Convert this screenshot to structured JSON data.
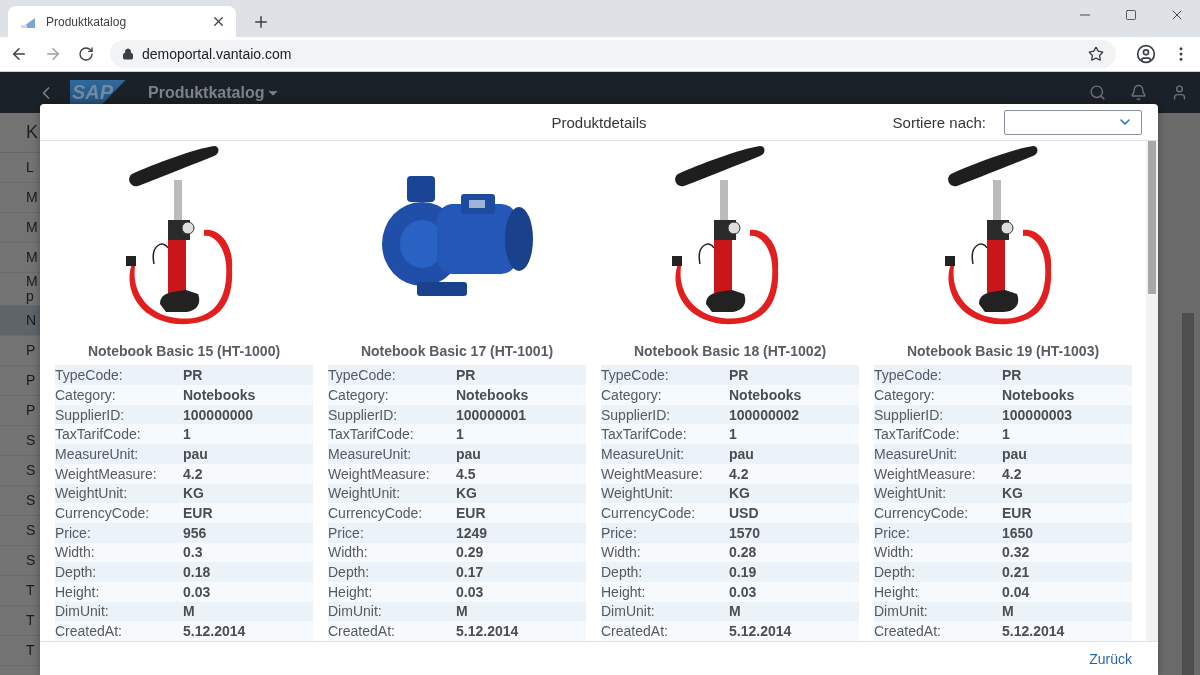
{
  "browser": {
    "tab": {
      "title": "Produktkatalog"
    },
    "url": "demoportal.vantaio.com"
  },
  "shell": {
    "logo": "SAP",
    "title": "Produktkatalog"
  },
  "background_list": {
    "header": "K",
    "items": [
      {
        "label": "L",
        "selected": false
      },
      {
        "label": "M",
        "selected": false
      },
      {
        "label": "M",
        "selected": false
      },
      {
        "label": "M",
        "selected": false
      },
      {
        "label": "M p",
        "selected": false
      },
      {
        "label": "N",
        "selected": true
      },
      {
        "label": "P",
        "selected": false
      },
      {
        "label": "P",
        "selected": false
      },
      {
        "label": "P",
        "selected": false
      },
      {
        "label": "S",
        "selected": false
      },
      {
        "label": "S",
        "selected": false
      },
      {
        "label": "S",
        "selected": false
      },
      {
        "label": "S",
        "selected": false
      },
      {
        "label": "S",
        "selected": false
      },
      {
        "label": "T",
        "selected": false
      },
      {
        "label": "T",
        "selected": false
      },
      {
        "label": "T",
        "selected": false
      }
    ]
  },
  "dialog": {
    "title": "Produktdetails",
    "sort_label": "Sortiere nach:",
    "footer_button": "Zurück",
    "products": [
      {
        "kind": "air-pump",
        "title": "Notebook Basic 15 (HT-1000)",
        "fields": [
          [
            "TypeCode:",
            "PR"
          ],
          [
            "Category:",
            "Notebooks"
          ],
          [
            "SupplierID:",
            "100000000"
          ],
          [
            "TaxTarifCode:",
            "1"
          ],
          [
            "MeasureUnit:",
            "pau"
          ],
          [
            "WeightMeasure:",
            "4.2"
          ],
          [
            "WeightUnit:",
            "KG"
          ],
          [
            "CurrencyCode:",
            "EUR"
          ],
          [
            "Price:",
            "956"
          ],
          [
            "Width:",
            "0.3"
          ],
          [
            "Depth:",
            "0.18"
          ],
          [
            "Height:",
            "0.03"
          ],
          [
            "DimUnit:",
            "M"
          ],
          [
            "CreatedAt:",
            "5.12.2014"
          ]
        ]
      },
      {
        "kind": "water-pump",
        "title": "Notebook Basic 17 (HT-1001)",
        "fields": [
          [
            "TypeCode:",
            "PR"
          ],
          [
            "Category:",
            "Notebooks"
          ],
          [
            "SupplierID:",
            "100000001"
          ],
          [
            "TaxTarifCode:",
            "1"
          ],
          [
            "MeasureUnit:",
            "pau"
          ],
          [
            "WeightMeasure:",
            "4.5"
          ],
          [
            "WeightUnit:",
            "KG"
          ],
          [
            "CurrencyCode:",
            "EUR"
          ],
          [
            "Price:",
            "1249"
          ],
          [
            "Width:",
            "0.29"
          ],
          [
            "Depth:",
            "0.17"
          ],
          [
            "Height:",
            "0.03"
          ],
          [
            "DimUnit:",
            "M"
          ],
          [
            "CreatedAt:",
            "5.12.2014"
          ]
        ]
      },
      {
        "kind": "air-pump",
        "title": "Notebook Basic 18 (HT-1002)",
        "fields": [
          [
            "TypeCode:",
            "PR"
          ],
          [
            "Category:",
            "Notebooks"
          ],
          [
            "SupplierID:",
            "100000002"
          ],
          [
            "TaxTarifCode:",
            "1"
          ],
          [
            "MeasureUnit:",
            "pau"
          ],
          [
            "WeightMeasure:",
            "4.2"
          ],
          [
            "WeightUnit:",
            "KG"
          ],
          [
            "CurrencyCode:",
            "USD"
          ],
          [
            "Price:",
            "1570"
          ],
          [
            "Width:",
            "0.28"
          ],
          [
            "Depth:",
            "0.19"
          ],
          [
            "Height:",
            "0.03"
          ],
          [
            "DimUnit:",
            "M"
          ],
          [
            "CreatedAt:",
            "5.12.2014"
          ]
        ]
      },
      {
        "kind": "air-pump",
        "title": "Notebook Basic 19 (HT-1003)",
        "fields": [
          [
            "TypeCode:",
            "PR"
          ],
          [
            "Category:",
            "Notebooks"
          ],
          [
            "SupplierID:",
            "100000003"
          ],
          [
            "TaxTarifCode:",
            "1"
          ],
          [
            "MeasureUnit:",
            "pau"
          ],
          [
            "WeightMeasure:",
            "4.2"
          ],
          [
            "WeightUnit:",
            "KG"
          ],
          [
            "CurrencyCode:",
            "EUR"
          ],
          [
            "Price:",
            "1650"
          ],
          [
            "Width:",
            "0.32"
          ],
          [
            "Depth:",
            "0.21"
          ],
          [
            "Height:",
            "0.04"
          ],
          [
            "DimUnit:",
            "M"
          ],
          [
            "CreatedAt:",
            "5.12.2014"
          ]
        ]
      }
    ]
  }
}
